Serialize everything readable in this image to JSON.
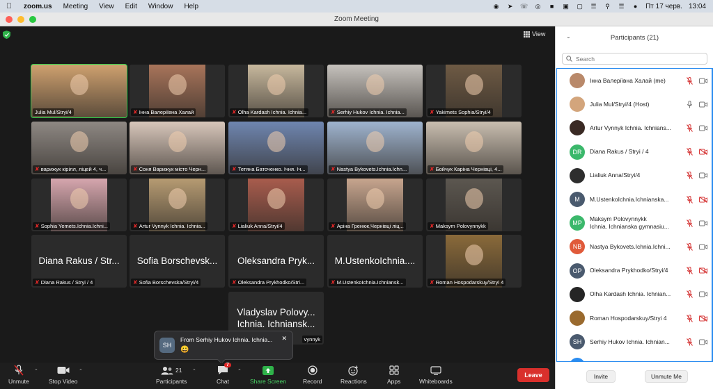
{
  "menubar": {
    "app": "zoom.us",
    "items": [
      "Meeting",
      "View",
      "Edit",
      "Window",
      "Help"
    ],
    "clock": "Пт 17 черв.",
    "time": "13:04"
  },
  "window": {
    "title": "Zoom Meeting",
    "view_label": "View"
  },
  "tiles": [
    {
      "name": "Julia Mul/Stryi/4",
      "muted": false,
      "active": true,
      "bg": "#cfa16f"
    },
    {
      "name": "Інна Валеріївна Халай",
      "muted": true,
      "active": false,
      "bg": "#a8745a"
    },
    {
      "name": "Olha Kardash Ichnia. Ichnia...",
      "muted": true,
      "active": false,
      "bg": "#c7b89d"
    },
    {
      "name": "Serhiy Hukov Ichnia. Ichnia...",
      "muted": true,
      "active": false,
      "bg": "#c6c2bd"
    },
    {
      "name": "Yakimets Sophia/Stryi/4",
      "muted": true,
      "active": false,
      "bg": "#6e5a44"
    },
    {
      "name": "варижук кірілл, ліцей 4, ч...",
      "muted": true,
      "active": false,
      "bg": "#8e8883"
    },
    {
      "name": "Соня Варижук місто Черн...",
      "muted": true,
      "active": false,
      "bg": "#d8c7bb"
    },
    {
      "name": "Тетяна Баточенко. Ічня. Іч...",
      "muted": true,
      "active": false,
      "bg": "#6f86b0"
    },
    {
      "name": "Nastya Bykovets.Ichnia.Ichn...",
      "muted": true,
      "active": false,
      "bg": "#9fb4cf"
    },
    {
      "name": "Бойчук Каріна Чернівці, 4...",
      "muted": true,
      "active": false,
      "bg": "#c9beb0"
    },
    {
      "name": "Sophia Yemets.Ichnia.Ichni...",
      "muted": true,
      "active": false,
      "bg": "#d6a6ae"
    },
    {
      "name": "Artur Vynnyk Ichnia. Ichnia...",
      "muted": true,
      "active": false,
      "bg": "#b69b72"
    },
    {
      "name": "Lialiuk Anna/Stryi/4",
      "muted": true,
      "active": false,
      "bg": "#a85c4d"
    },
    {
      "name": "Аріна Гренюк,Чернівці ліц...",
      "muted": true,
      "active": false,
      "bg": "#c7a58e"
    },
    {
      "name": "Maksym Polovynnykk",
      "muted": true,
      "active": false,
      "bg": "#5c5750"
    },
    {
      "name": "Diana Rakus / Stryi / 4",
      "muted": true,
      "active": false,
      "big": "Diana Rakus / Str..."
    },
    {
      "name": "Sofia Borschevska/Stryi/4",
      "muted": true,
      "active": false,
      "big": "Sofia Borschevsk..."
    },
    {
      "name": "Oleksandra Prykhodko/Stri...",
      "muted": true,
      "active": false,
      "big": "Oleksandra Pryk..."
    },
    {
      "name": "M.UstenkoIchnia.Ichniansk...",
      "muted": true,
      "active": false,
      "big": "M.UstenkoIchnia...."
    },
    {
      "name": "Roman Hospodarskuy/Stryi 4",
      "muted": true,
      "active": false,
      "bg": "#8a6a3a"
    },
    {
      "name": "vynnyk",
      "muted": false,
      "active": false,
      "big": "Vladyslav Polovy...",
      "big2": "Ichnia. Ichniansk..."
    }
  ],
  "chat_popup": {
    "initials": "SH",
    "message": "From Serhiy Hukov Ichnia. Ichnia...",
    "emoji": "😀",
    "close": "✕"
  },
  "toolbar": {
    "unmute": "Unmute",
    "stop_video": "Stop Video",
    "participants": "Participants",
    "participants_count": "21",
    "chat": "Chat",
    "chat_badge": "7",
    "share": "Share Screen",
    "record": "Record",
    "reactions": "Reactions",
    "apps": "Apps",
    "whiteboards": "Whiteboards",
    "leave": "Leave"
  },
  "panel": {
    "title": "Participants (21)",
    "search_placeholder": "Search",
    "participants": [
      {
        "name": "Інна Валеріївна Халай (me)",
        "initials": "",
        "color": "#b9896a",
        "mic": "muted",
        "video": "on"
      },
      {
        "name": "Julia Mul/Stryi/4 (Host)",
        "initials": "",
        "color": "#d3a57c",
        "mic": "on",
        "video": "on"
      },
      {
        "name": "Artur Vynnyk Ichnia. Ichnians...",
        "initials": "",
        "color": "#3a2a24",
        "mic": "muted",
        "video": "on"
      },
      {
        "name": "Diana Rakus / Stryi / 4",
        "initials": "DR",
        "color": "#3bb86b",
        "mic": "muted",
        "video": "off"
      },
      {
        "name": "Lialiuk Anna/Stryi/4",
        "initials": "",
        "color": "#2e2e2e",
        "mic": "muted",
        "video": "on"
      },
      {
        "name": "M.UstenkoIchnia.Ichnianska...",
        "initials": "M",
        "color": "#4a5a6e",
        "mic": "muted",
        "video": "off"
      },
      {
        "name": "Maksym Polovynnykk",
        "name2": "Ichnia. Ichnianska gymnasiu...",
        "initials": "MP",
        "color": "#3bb86b",
        "mic": "muted",
        "video": "on"
      },
      {
        "name": "Nastya Bykovets.Ichnia.Ichni...",
        "initials": "NB",
        "color": "#e05a3a",
        "mic": "muted",
        "video": "on"
      },
      {
        "name": "Oleksandra Prykhodko/Stryi/4",
        "initials": "OP",
        "color": "#4a5a6e",
        "mic": "muted",
        "video": "off"
      },
      {
        "name": "Olha Kardash Ichnia. Ichnian...",
        "initials": "",
        "color": "#252525",
        "mic": "muted",
        "video": "on"
      },
      {
        "name": "Roman Hospodarskuy/Stryi 4",
        "initials": "",
        "color": "#9a6a2e",
        "mic": "muted",
        "video": "off"
      },
      {
        "name": "Serhiy Hukov Ichnia. Ichnian...",
        "initials": "SH",
        "color": "#4a5a6e",
        "mic": "muted",
        "video": "on"
      }
    ],
    "invite": "Invite",
    "unmute_me": "Unmute Me"
  }
}
